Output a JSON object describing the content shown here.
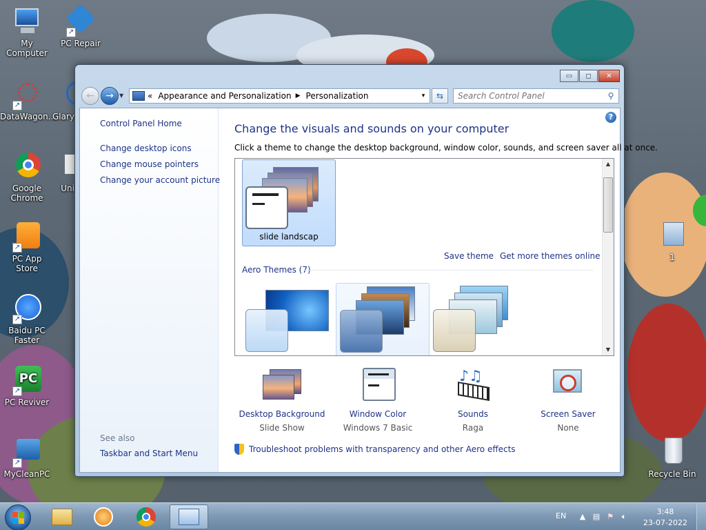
{
  "desktop": {
    "icons": [
      {
        "label": "My Computer"
      },
      {
        "label": "PC Repair"
      },
      {
        "label": "DataWagon..."
      },
      {
        "label": "Glary"
      },
      {
        "label": "Google Chrome"
      },
      {
        "label": "Uni"
      },
      {
        "label": "PC App Store"
      },
      {
        "label": "Baidu PC Faster"
      },
      {
        "label": "PC Reviver"
      },
      {
        "label": "MyCleanPC"
      },
      {
        "label": "1"
      },
      {
        "label": "Recycle Bin"
      }
    ]
  },
  "window": {
    "caption_buttons": {
      "minimize": "▭",
      "maximize": "◻",
      "close": "✕"
    },
    "address": {
      "overflow": "«",
      "crumbs": [
        "Appearance and Personalization",
        "Personalization"
      ],
      "separator": "▶",
      "dropdown": "▾"
    },
    "search": {
      "placeholder": "Search Control Panel"
    },
    "help": "?",
    "left_pane": {
      "home": "Control Panel Home",
      "links": [
        "Change desktop icons",
        "Change mouse pointers",
        "Change your account picture"
      ],
      "see_also": "See also",
      "see_also_links": [
        "Taskbar and Start Menu"
      ]
    },
    "main": {
      "title": "Change the visuals and sounds on your computer",
      "subtitle": "Click a theme to change the desktop background, window color, sounds, and screen saver all at once.",
      "my_theme": {
        "label": "slide landscap",
        "selected": true
      },
      "save_theme": "Save theme",
      "get_more": "Get more themes online",
      "aero_header": "Aero Themes (7)",
      "options": [
        {
          "title": "Desktop Background",
          "value": "Slide Show",
          "icon": "desktop-background-icon"
        },
        {
          "title": "Window Color",
          "value": "Windows 7 Basic",
          "icon": "window-color-icon"
        },
        {
          "title": "Sounds",
          "value": "Raga",
          "icon": "sounds-icon"
        },
        {
          "title": "Screen Saver",
          "value": "None",
          "icon": "screen-saver-icon"
        }
      ],
      "troubleshoot": "Troubleshoot problems with transparency and other Aero effects"
    }
  },
  "taskbar": {
    "language": "EN",
    "time": "3:48",
    "date": "23-07-2022"
  },
  "colors": {
    "link": "#1e3287",
    "window_frame": "#b6cce3",
    "taskbar": "#7e98b3"
  }
}
